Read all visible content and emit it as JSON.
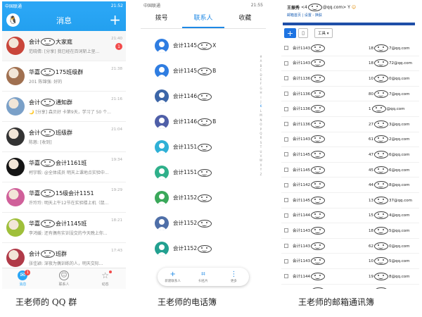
{
  "qq": {
    "status_left": "中国联通",
    "status_right": "21:52",
    "title": "消息",
    "plus_label": "+",
    "chats": [
      {
        "name_pre": "会计",
        "name_post": "大家庭",
        "msg": "范晓倩: [分享] 我已经在百词斩上坚...",
        "time": "21:40",
        "badge": "1",
        "avatar_color": "#c9453a"
      },
      {
        "name_pre": "华嘉",
        "name_post": "175班级群",
        "msg": "201  陈锦强: 好的",
        "time": "21:38",
        "badge": "",
        "avatar_color": "#a07050"
      },
      {
        "name_pre": "会计",
        "name_post": "通知群",
        "msg": "🌙 [分享] 森贝好 卡第9天，学习了 50 个...",
        "time": "21:16",
        "badge": "",
        "avatar_color": "#7aa0c8"
      },
      {
        "name_pre": "会计",
        "name_post": "班级群",
        "msg": "陈慈: [收到]",
        "time": "21:04",
        "badge": "",
        "avatar_color": "#333333"
      },
      {
        "name_pre": "华嘉",
        "name_post": "会计1161班",
        "msg": "柯宇毅: @全体成员 明天上课地点实验中...",
        "time": "19:34",
        "badge": "",
        "avatar_color": "#151515"
      },
      {
        "name_pre": "华嘉",
        "name_post": "15级会计1151",
        "msg": "许玲玲: 明天上午12节在实验楼上机（鼠...",
        "time": "19:29",
        "badge": "",
        "avatar_color": "#d0609a"
      },
      {
        "name_pre": "华嘉",
        "name_post": "会计1145班",
        "msg": "李鸿媛: 还有偶有实训没交的今天晚上你...",
        "time": "18:21",
        "badge": "",
        "avatar_color": "#9fbf3a"
      },
      {
        "name_pre": "会计",
        "name_post": "班群",
        "msg": "张佳颖: 深夜为偶训练的人，明天交际...",
        "time": "17:43",
        "badge": "",
        "avatar_color": "#b03a48"
      }
    ],
    "tabs": [
      {
        "label": "消息",
        "badge": "1"
      },
      {
        "label": "联系人",
        "badge": ""
      },
      {
        "label": "动态",
        "badge": ""
      }
    ]
  },
  "phone": {
    "status_left": "中国联通",
    "status_right": "21:55",
    "tabs": [
      "拨号",
      "联系人",
      "收藏"
    ],
    "contacts": [
      {
        "pre": "会计1145",
        "post": "X",
        "color": "#2f7de1"
      },
      {
        "pre": "会计1145",
        "post": "B",
        "color": "#2f7de1"
      },
      {
        "pre": "会计1146",
        "post": "",
        "color": "#3c66a8"
      },
      {
        "pre": "会计1146",
        "post": "B",
        "color": "#4f5fa8"
      },
      {
        "pre": "会计1151",
        "post": "",
        "color": "#2fb0d6"
      },
      {
        "pre": "会计1151",
        "post": "",
        "color": "#2fb08a"
      },
      {
        "pre": "会计1152",
        "post": "",
        "color": "#3aa85a"
      },
      {
        "pre": "会计1152",
        "post": "",
        "color": "#4f6fa8"
      },
      {
        "pre": "会计1152",
        "post": "",
        "color": "#22a090"
      }
    ],
    "index": [
      "#",
      "A",
      "B",
      "C",
      "D",
      "E",
      "F",
      "G",
      "H",
      "I",
      "J",
      "K",
      "L",
      "M",
      "N",
      "O",
      "P",
      "Q",
      "R",
      "S",
      "T",
      "U",
      "V",
      "W",
      "X",
      "Y",
      "Z"
    ],
    "actions": [
      {
        "icon": "+",
        "label": "新建联系人"
      },
      {
        "icon": "⌗",
        "label": "扫名片"
      },
      {
        "icon": "⋮",
        "label": "更多"
      }
    ]
  },
  "email": {
    "user_label": "王振秀",
    "user_email_pre": "<4",
    "user_email_post": "@qq.com>",
    "user_suffix": "Y",
    "links": "邮箱首页 | 设置 - 换肤",
    "plus_label": "+",
    "tools_label": "工具 ▾",
    "rows": [
      {
        "name": "会计1143",
        "email_pre": "18",
        "email_post": "7@qq.com"
      },
      {
        "name": "会计1143",
        "email_pre": "18",
        "email_post": "72@qq.com"
      },
      {
        "name": "会计1136",
        "email_pre": "10",
        "email_post": "0@qq.com"
      },
      {
        "name": "会计1136",
        "email_pre": "80",
        "email_post": "7@qq.com"
      },
      {
        "name": "会计1136",
        "email_pre": "1",
        "email_post": "@qq.com"
      },
      {
        "name": "会计1136",
        "email_pre": "27",
        "email_post": "3@qq.com"
      },
      {
        "name": "会计1143",
        "email_pre": "61",
        "email_post": "2@qq.com"
      },
      {
        "name": "会计1145",
        "email_pre": "47",
        "email_post": "6@qq.com"
      },
      {
        "name": "会计1145",
        "email_pre": "45",
        "email_post": "6@qq.com"
      },
      {
        "name": "会计1142",
        "email_pre": "44",
        "email_post": "8@qq.com"
      },
      {
        "name": "会计1145",
        "email_pre": "13",
        "email_post": "37@qq.com"
      },
      {
        "name": "会计1144",
        "email_pre": "15",
        "email_post": "4@qq.com"
      },
      {
        "name": "会计1143",
        "email_pre": "18",
        "email_post": "5@qq.com"
      },
      {
        "name": "会计1143",
        "email_pre": "62",
        "email_post": "0@qq.com"
      },
      {
        "name": "会计1143",
        "email_pre": "10",
        "email_post": "5@qq.com"
      },
      {
        "name": "会计1144",
        "email_pre": "19",
        "email_post": "8@qq.com"
      },
      {
        "name": "会计1144",
        "email_pre": "19",
        "email_post": "4@qq.com"
      }
    ]
  },
  "captions": [
    "王老师的 QQ 群",
    "王老师的电话簿",
    "王老师的邮箱通讯簿"
  ]
}
